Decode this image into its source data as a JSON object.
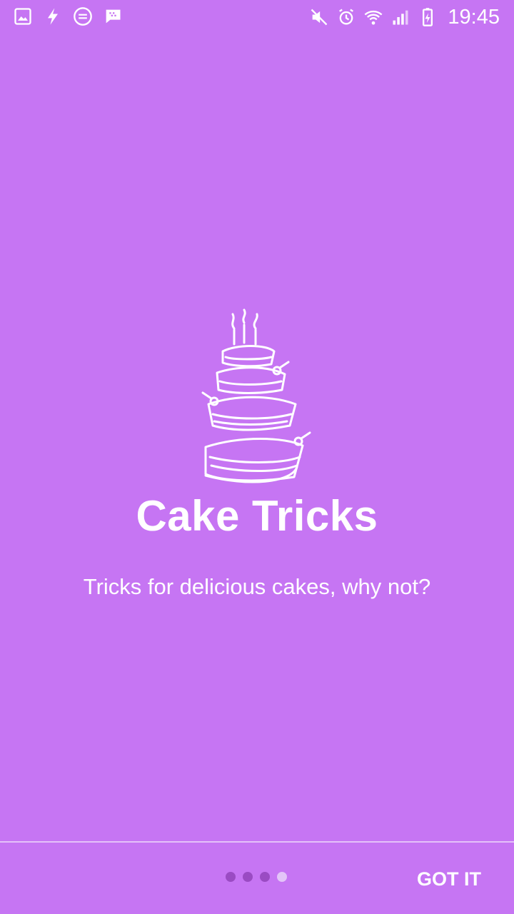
{
  "status_bar": {
    "time": "19:45",
    "left_icons": [
      "gallery-icon",
      "flash-icon",
      "webtoon-icon",
      "bbm-icon"
    ],
    "right_icons": [
      "mute-icon",
      "alarm-icon",
      "wifi-icon",
      "signal-icon",
      "battery-charging-icon"
    ]
  },
  "slide": {
    "title": "Cake Tricks",
    "subtitle": "Tricks for delicious cakes, why not?"
  },
  "pager": {
    "count": 4,
    "active_index": 3
  },
  "footer": {
    "done_label": "GOT IT"
  },
  "colors": {
    "background": "#c675f3",
    "dot_inactive": "#9a4bc3",
    "dot_active": "#e3c4f8"
  }
}
